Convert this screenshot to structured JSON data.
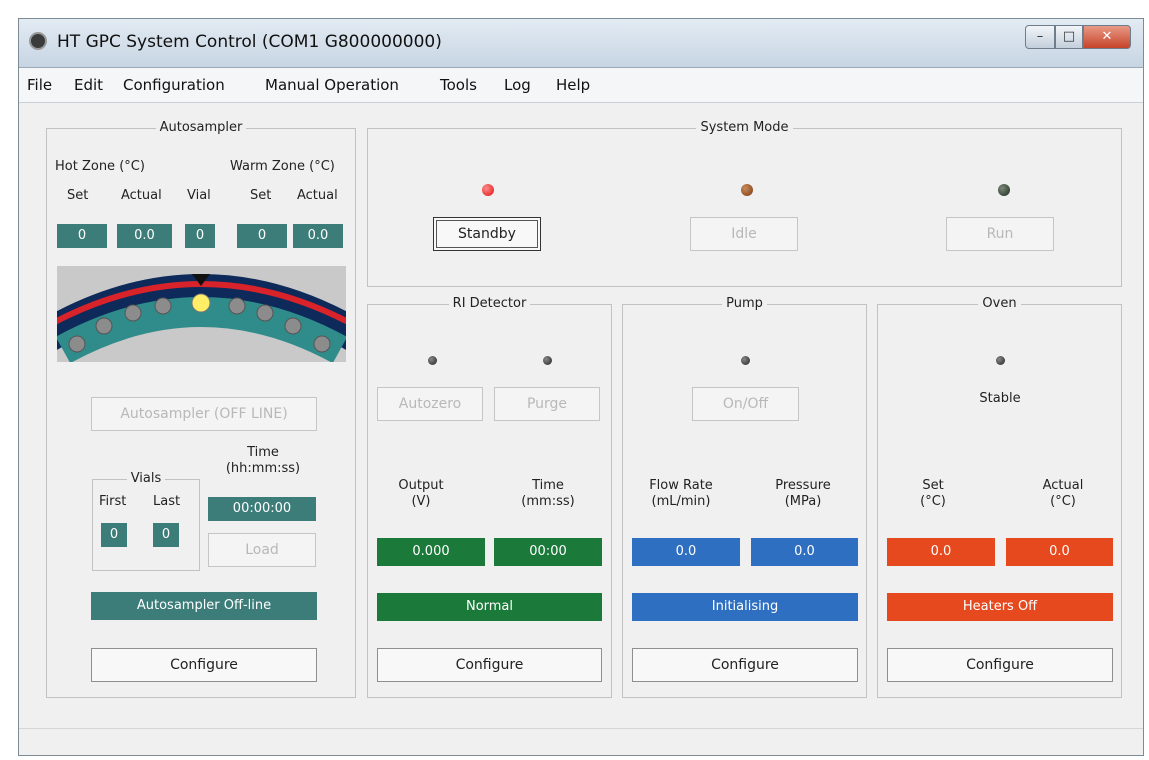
{
  "window": {
    "title": "HT GPC System Control (COM1 G800000000)"
  },
  "menu": [
    "File",
    "Edit",
    "Configuration",
    "Manual Operation",
    "Tools",
    "Log",
    "Help"
  ],
  "colors": {
    "teal": "#3c7d7a",
    "green": "#1b7a3a",
    "blue": "#2f6fc1",
    "orange_red": "#e6491e"
  },
  "autosampler": {
    "title": "Autosampler",
    "hot_zone_label": "Hot Zone (°C)",
    "warm_zone_label": "Warm Zone (°C)",
    "set_label": "Set",
    "actual_label": "Actual",
    "vial_label": "Vial",
    "hot_set": "0",
    "hot_actual": "0.0",
    "vial": "0",
    "warm_set": "0",
    "warm_actual": "0.0",
    "carousel_icon": "vial-carousel-icon",
    "status_button": "Autosampler (OFF LINE)",
    "vials_group": "Vials",
    "first_label": "First",
    "last_label": "Last",
    "first": "0",
    "last": "0",
    "time_label": "Time\n(hh:mm:ss)",
    "time": "00:00:00",
    "load_button": "Load",
    "status": "Autosampler Off-line",
    "configure_button": "Configure"
  },
  "system_mode": {
    "title": "System Mode",
    "standby": "Standby",
    "idle": "Idle",
    "run": "Run"
  },
  "ri_detector": {
    "title": "RI Detector",
    "autozero_button": "Autozero",
    "purge_button": "Purge",
    "output_label": "Output\n(V)",
    "time_label": "Time\n(mm:ss)",
    "output": "0.000",
    "time": "00:00",
    "status": "Normal",
    "configure_button": "Configure"
  },
  "pump": {
    "title": "Pump",
    "onoff_button": "On/Off",
    "flow_label": "Flow Rate\n(mL/min)",
    "pressure_label": "Pressure\n(MPa)",
    "flow": "0.0",
    "pressure": "0.0",
    "status": "Initialising",
    "configure_button": "Configure"
  },
  "oven": {
    "title": "Oven",
    "stable_label": "Stable",
    "set_label": "Set\n(°C)",
    "actual_label": "Actual\n(°C)",
    "set": "0.0",
    "actual": "0.0",
    "status": "Heaters Off",
    "configure_button": "Configure"
  }
}
